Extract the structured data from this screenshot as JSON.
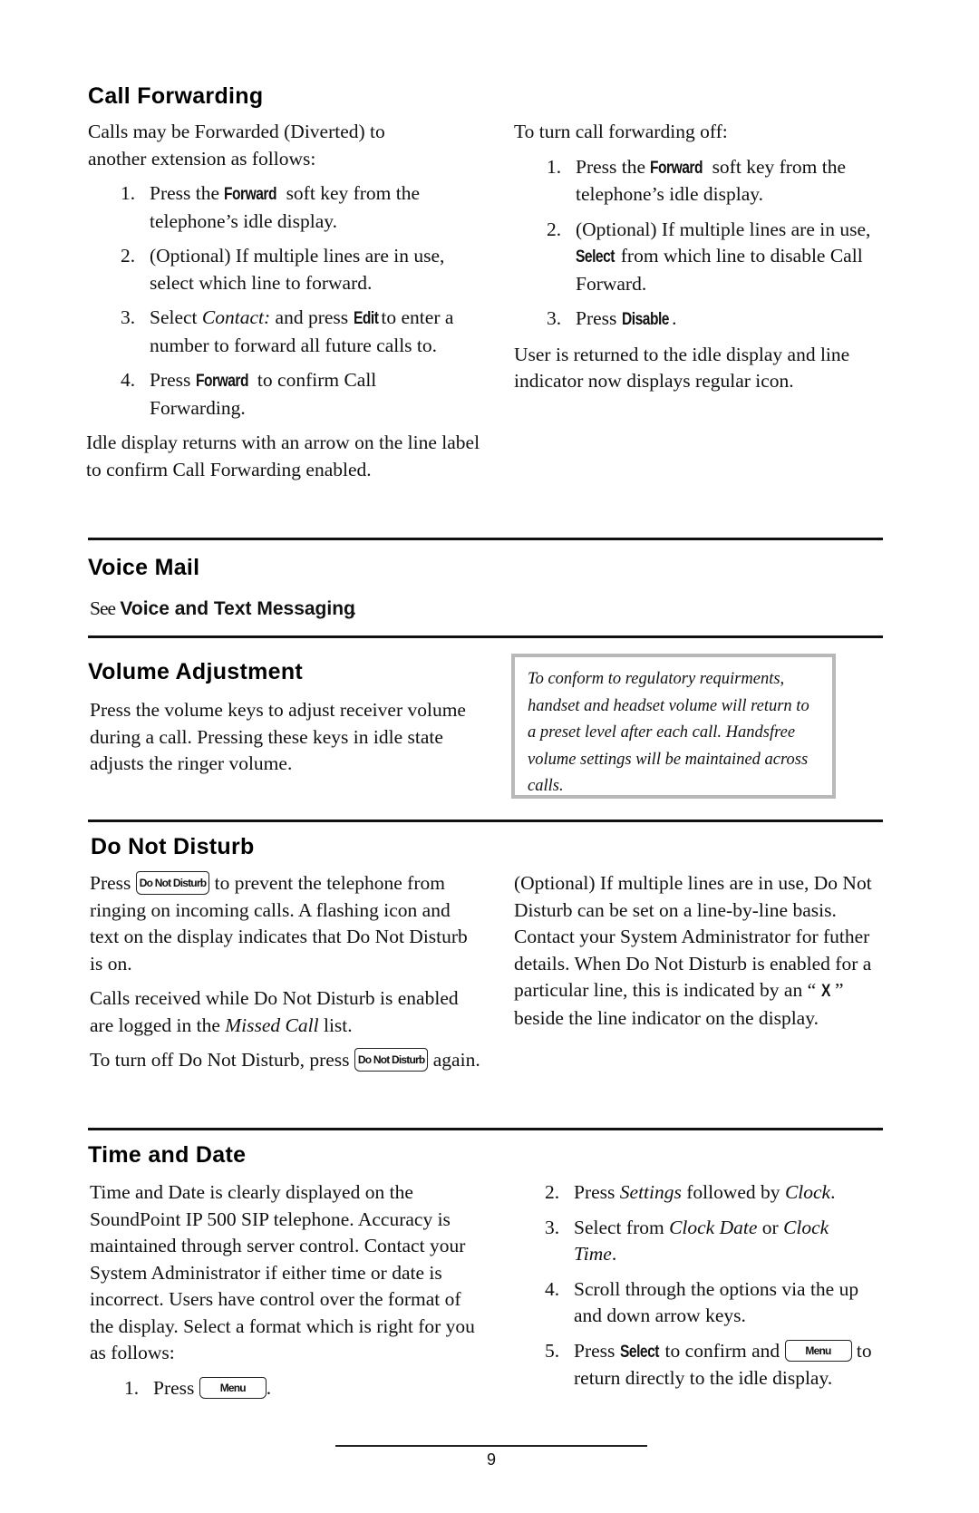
{
  "page_number": "9",
  "call_forwarding": {
    "heading": "Call Forwarding",
    "intro": "Calls may be Forwarded (Diverted) to another extension as follows:",
    "steps": [
      {
        "num": "1.",
        "pre": "Press the ",
        "key": "Forward",
        "post": " soft key from the telephone’s idle display."
      },
      {
        "num": "2.",
        "text": "(Optional) If multiple lines are in use, select which line to forward."
      },
      {
        "num": "3.",
        "pre": "Select ",
        "italic": "Contact:",
        "mid": " and press ",
        "key": "Edit",
        "post": " to enter a number to forward all future calls to."
      },
      {
        "num": "4.",
        "pre": "Press ",
        "key": "Forward",
        "post": " to confirm Call Forwarding."
      }
    ],
    "outro": "Idle display returns with an arrow on the line label to confirm Call Forwarding enabled.",
    "off_intro": "To turn call forwarding off:",
    "off_steps": [
      {
        "num": "1.",
        "pre": "Press the ",
        "key": "Forward",
        "post": " soft key from the telephone’s idle display."
      },
      {
        "num": "2.",
        "pre": "(Optional) If multiple lines are in use, ",
        "key": "Select",
        "post": " from which line to disable Call Forward."
      },
      {
        "num": "3.",
        "pre": "Press ",
        "key": "Disable",
        "post": "."
      }
    ],
    "off_outro": "User is returned to the idle display and line indicator now displays regular icon."
  },
  "voice_mail": {
    "heading": "Voice Mail",
    "see": "See",
    "link": "Voice and Text Messaging",
    "period": "."
  },
  "volume": {
    "heading": "Volume Adjustment",
    "body": "Press the volume keys to adjust receiver volume during a call.  Pressing these keys in idle state adjusts the ringer volume.",
    "note": "To conform to regulatory requirments, handset and headset volume will return to a preset level after each call.  Handsfree volume settings will be maintained across calls."
  },
  "dnd": {
    "heading": "Do Not Disturb",
    "key_label": "Do Not Disturb",
    "p1_pre": "Press ",
    "p1_post": " to prevent the telephone from ringing on incoming calls.  A flashing icon and text on the display indicates that Do Not Disturb is on.",
    "p2_pre": "Calls received while Do Not Disturb is enabled are logged in the ",
    "p2_italic": "Missed Call",
    "p2_post": " list.",
    "p3_pre": "To turn off Do Not Disturb, press ",
    "p3_post": " again.",
    "right_pre": "(Optional) If multiple lines are in use, Do Not Disturb can be set on a line-by-line basis.  Contact your System Administrator for futher details.  When Do Not Disturb is enabled for a particular line, this is indicated by an “ ",
    "right_symbol": "X",
    "right_post": " ” beside the line indicator on the display."
  },
  "time_date": {
    "heading": "Time and Date",
    "body": "Time and Date is clearly displayed on the SoundPoint IP 500 SIP telephone.  Accuracy is maintained through server control.  Contact your System Administrator if either time or date is incorrect.  Users have control over the format of the display.  Select a format which is right for you as follows:",
    "menu_key": "Menu",
    "step1": {
      "num": "1.",
      "pre": "Press ",
      "post": "."
    },
    "step2": {
      "num": "2.",
      "pre": "Press ",
      "i1": "Settings",
      "mid": " followed by ",
      "i2": "Clock",
      "post": "."
    },
    "step3": {
      "num": "3.",
      "pre": "Select from ",
      "i1": "Clock Date",
      "mid": " or ",
      "i2": "Clock Time",
      "post": "."
    },
    "step4": {
      "num": "4.",
      "text": "Scroll through the options via the up and down arrow keys."
    },
    "step5": {
      "num": "5.",
      "pre": "Press ",
      "key": "Select",
      "mid": " to confirm and ",
      "post": " to return directly to the idle display."
    }
  }
}
